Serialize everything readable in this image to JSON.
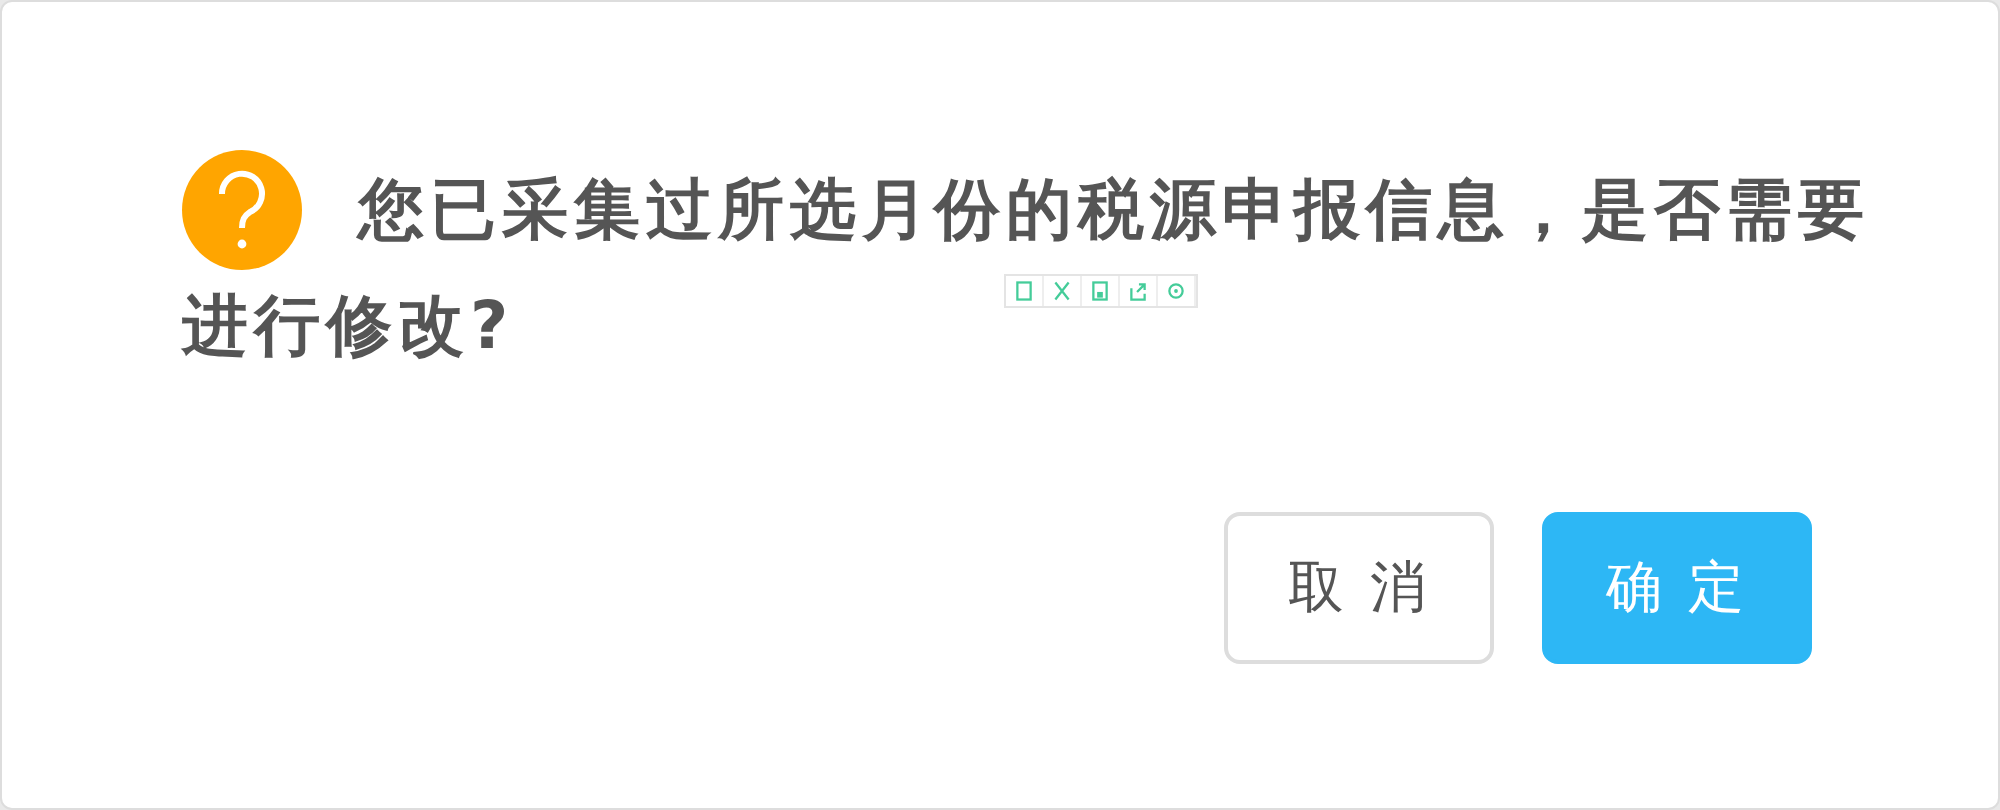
{
  "dialog": {
    "message_lines": [
      "您已采集过所选月份的税源申报信息，是否需要",
      "进行修改?"
    ],
    "buttons": [
      {
        "label": "取 消",
        "kind": "secondary"
      },
      {
        "label": "确 定",
        "kind": "primary"
      }
    ]
  }
}
